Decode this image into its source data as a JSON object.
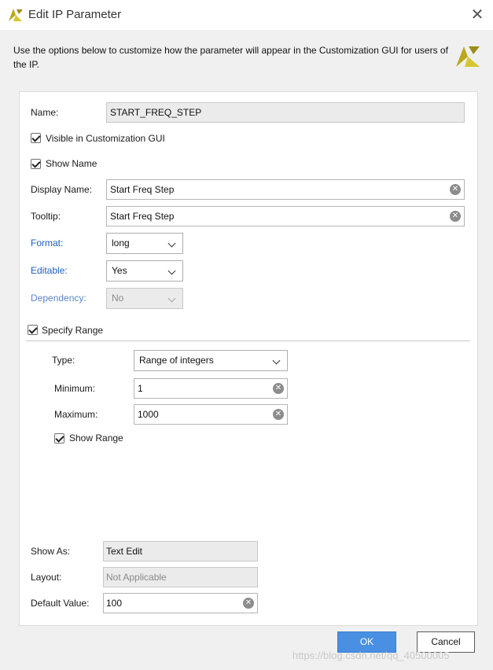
{
  "window": {
    "title": "Edit IP Parameter",
    "description": "Use the options below to customize how the parameter will appear in the Customization GUI for users of the IP."
  },
  "form": {
    "name_label": "Name:",
    "name_value": "START_FREQ_STEP",
    "visible_label": "Visible in Customization GUI",
    "visible_checked": true,
    "show_name_label": "Show Name",
    "show_name_checked": true,
    "display_name_label": "Display Name:",
    "display_name_value": "Start Freq Step",
    "tooltip_label": "Tooltip:",
    "tooltip_value": "Start Freq Step",
    "format_label": "Format:",
    "format_value": "long",
    "editable_label": "Editable:",
    "editable_value": "Yes",
    "dependency_label": "Dependency:",
    "dependency_value": "No",
    "specify_range_label": "Specify Range",
    "specify_range_checked": true
  },
  "range": {
    "type_label": "Type:",
    "type_value": "Range of integers",
    "minimum_label": "Minimum:",
    "minimum_value": "1",
    "maximum_label": "Maximum:",
    "maximum_value": "1000",
    "show_range_label": "Show Range",
    "show_range_checked": true
  },
  "bottom": {
    "show_as_label": "Show As:",
    "show_as_value": "Text Edit",
    "layout_label": "Layout:",
    "layout_value": "Not Applicable",
    "default_value_label": "Default Value:",
    "default_value": "100"
  },
  "buttons": {
    "ok": "OK",
    "cancel": "Cancel"
  },
  "watermark": "https://blog.csdn.net/qq_40500005",
  "colors": {
    "accent_blue": "#4a90e2",
    "link_label_blue": "#1f5fbf",
    "logo_yellow": "#c8b81e"
  }
}
